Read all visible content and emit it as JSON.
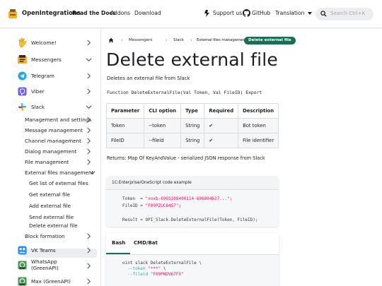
{
  "navbar": {
    "brand": "OpenIntegrations",
    "links": [
      "Read the Docs",
      "Addons",
      "Download"
    ],
    "support": "Support us",
    "github": "GitHub",
    "translation": "Translation",
    "search_placeholder": "Search Ctrl+K"
  },
  "sidebar": {
    "items": [
      {
        "label": "Welcome!"
      },
      {
        "label": "Messengers"
      },
      {
        "label": "Telegram"
      },
      {
        "label": "Viber"
      },
      {
        "label": "Slack"
      },
      {
        "label": "Management and settings"
      },
      {
        "label": "Message management"
      },
      {
        "label": "Channel management"
      },
      {
        "label": "Dialog management"
      },
      {
        "label": "File management"
      },
      {
        "label": "External files management"
      },
      {
        "label": "Get list of external files"
      },
      {
        "label": "Get external file"
      },
      {
        "label": "Add external file"
      },
      {
        "label": "Send external file"
      },
      {
        "label": "Delete external file"
      },
      {
        "label": "Block formation"
      },
      {
        "label": "VK Teams"
      },
      {
        "label": "WhatsApp (GreenAPI)"
      },
      {
        "label": "Max (GreenAPI)"
      }
    ]
  },
  "breadcrumb": [
    "Messengers",
    "Slack",
    "External files management",
    "Delete external file"
  ],
  "page": {
    "title": "Delete external file",
    "description": "Deletes an external file from Slack",
    "signature": "Function DeleteExternalFile(Val Token, Val FileID) Export",
    "returns": "Returns: Map Of KeyAndValue - serialized JSON response from Slack"
  },
  "params_table": {
    "headers": [
      "Parameter",
      "CLI option",
      "Type",
      "Required",
      "Description"
    ],
    "rows": [
      [
        "Token",
        "--token",
        "String",
        "✔",
        "Bot token"
      ],
      [
        "FileID",
        "--fileid",
        "String",
        "✔",
        "File identifier"
      ]
    ]
  },
  "code_example": {
    "header": "1C:Enterprise/OneScript code example",
    "token_label": "Token  = ",
    "token_value": "\"xoxb-6965308400114-696804637...\";",
    "fileid_label": "FileID = ",
    "fileid_value": "\"F09PZUC8457\";",
    "result_line": "Result = OPI_Slack.DeleteExternalFile(Token, FileID);"
  },
  "cli_tabs": {
    "tabs": [
      "Bash",
      "CMD/Bat"
    ],
    "line1": "oint slack DeleteExternalFile \\",
    "line2_opt": "--token ",
    "line2_val": "\"***\"",
    "line2_tail": " \\",
    "line3_opt": "--fileid ",
    "line3_val": "\"F09PNDV67FX\""
  }
}
